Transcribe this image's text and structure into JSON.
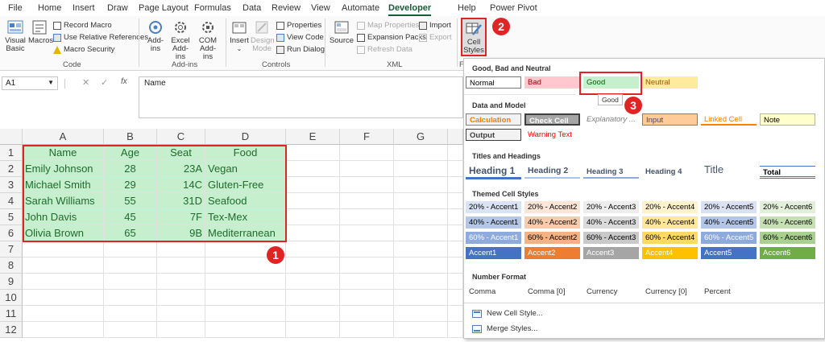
{
  "tabs": [
    "File",
    "Home",
    "Insert",
    "Draw",
    "Page Layout",
    "Formulas",
    "Data",
    "Review",
    "View",
    "Automate",
    "Developer",
    "Help",
    "Power Pivot"
  ],
  "active_tab": "Developer",
  "ribbon": {
    "code": {
      "visual_basic": "Visual Basic",
      "macros": "Macros",
      "record_macro": "Record Macro",
      "use_relative": "Use Relative References",
      "macro_security": "Macro Security",
      "label": "Code"
    },
    "addins": {
      "addins": "Add-ins",
      "excel_addins": "Excel Add-ins",
      "com_addins": "COM Add-ins",
      "label": "Add-ins"
    },
    "controls": {
      "insert": "Insert",
      "design_mode": "Design Mode",
      "properties": "Properties",
      "view_code": "View Code",
      "run_dialog": "Run Dialog",
      "label": "Controls"
    },
    "xml": {
      "source": "Source",
      "map_properties": "Map Properties",
      "expansion_packs": "Expansion Packs",
      "refresh_data": "Refresh Data",
      "import": "Import",
      "export": "Export",
      "label": "XML"
    },
    "styles": {
      "cell_styles": "Cell Styles",
      "label": "F"
    }
  },
  "formula_bar": {
    "name_box": "A1",
    "fx": "fx",
    "content": "Name"
  },
  "columns": [
    "A",
    "B",
    "C",
    "D",
    "E",
    "F",
    "G"
  ],
  "rows": [
    "1",
    "2",
    "3",
    "4",
    "5",
    "6",
    "7",
    "8",
    "9",
    "10",
    "11",
    "12"
  ],
  "table": {
    "header": [
      "Name",
      "Age",
      "Seat",
      "Food"
    ],
    "data": [
      [
        "Emily Johnson",
        "28",
        "23A",
        "Vegan"
      ],
      [
        "Michael Smith",
        "29",
        "14C",
        "Gluten-Free"
      ],
      [
        "Sarah Williams",
        "55",
        "31D",
        "Seafood"
      ],
      [
        "John Davis",
        "45",
        "7F",
        "Tex-Mex"
      ],
      [
        "Olivia Brown",
        "65",
        "9B",
        "Mediterranean"
      ]
    ]
  },
  "gallery": {
    "good_bad_neutral": {
      "title": "Good, Bad and Neutral",
      "items": [
        "Normal",
        "Bad",
        "Good",
        "Neutral"
      ]
    },
    "tooltip": "Good",
    "data_model": {
      "title": "Data and Model",
      "row1": [
        "Calculation",
        "Check Cell",
        "Explanatory ...",
        "Input",
        "Linked Cell",
        "Note"
      ],
      "row2": [
        "Output",
        "Warning Text"
      ]
    },
    "titles": {
      "title": "Titles and Headings",
      "items": [
        "Heading 1",
        "Heading 2",
        "Heading 3",
        "Heading 4",
        "Title",
        "Total"
      ]
    },
    "themed": {
      "title": "Themed Cell Styles",
      "rows": [
        [
          "20% - Accent1",
          "20% - Accent2",
          "20% - Accent3",
          "20% - Accent4",
          "20% - Accent5",
          "20% - Accent6"
        ],
        [
          "40% - Accent1",
          "40% - Accent2",
          "40% - Accent3",
          "40% - Accent4",
          "40% - Accent5",
          "40% - Accent6"
        ],
        [
          "60% - Accent1",
          "60% - Accent2",
          "60% - Accent3",
          "60% - Accent4",
          "60% - Accent5",
          "60% - Accent6"
        ],
        [
          "Accent1",
          "Accent2",
          "Accent3",
          "Accent4",
          "Accent5",
          "Accent6"
        ]
      ]
    },
    "number_format": {
      "title": "Number Format",
      "items": [
        "Comma",
        "Comma [0]",
        "Currency",
        "Currency [0]",
        "Percent"
      ]
    },
    "menu": [
      "New Cell Style...",
      "Merge Styles..."
    ]
  },
  "badges": [
    "1",
    "2",
    "3"
  ],
  "colors": {
    "accent": "#185c37",
    "highlight": "#e02424",
    "good_fill": "#c6efce",
    "good_text": "#1f6b2e"
  }
}
